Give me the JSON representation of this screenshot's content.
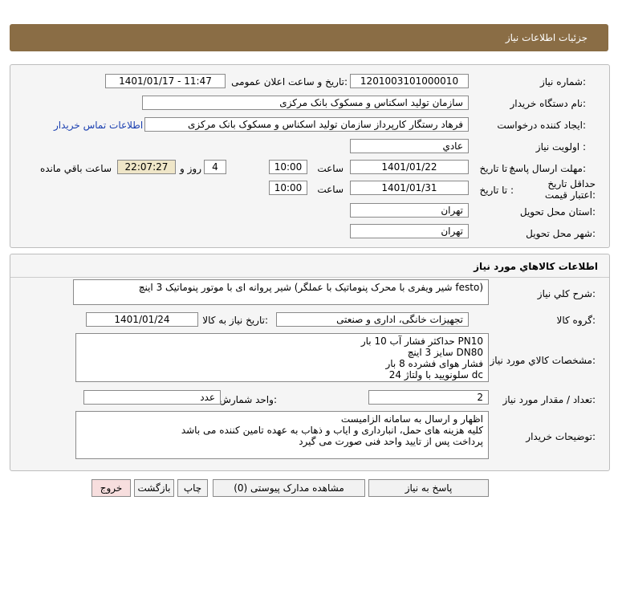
{
  "header": {
    "title": "جزئیات اطلاعات نیاز"
  },
  "need_info": {
    "need_number_label": "شماره نیاز:",
    "need_number": "1201003101000010",
    "announce_label": "تاریخ و ساعت اعلان عمومی:",
    "announce_value": "1401/01/17 - 11:47",
    "buyer_org_label": "نام دستگاه خریدار:",
    "buyer_org": "سازمان تولید اسکناس و مسکوک بانک مرکزی",
    "creator_label": "ایجاد کننده درخواست:",
    "creator": "فرهاد رستگار کارپرداز سازمان تولید اسکناس و مسکوک بانک مرکزی",
    "contact_link": "اطلاعات تماس خریدار",
    "priority_label": "اولویت نیاز :",
    "priority": "عادي",
    "deadline_label": "مهلت ارسال پاسخ:",
    "to_date_label": "تا تاریخ :",
    "deadline_date": "1401/01/22",
    "time_label": "ساعت",
    "deadline_time": "10:00",
    "days_value": "4",
    "days_label": "روز و",
    "remaining_time": "22:07:27",
    "remaining_label": "ساعت باقي مانده",
    "validity_label": "حداقل تاریخ اعتبار قیمت:",
    "validity_to_label": "تا تاریخ :",
    "validity_date": "1401/01/31",
    "validity_time_label": "ساعت",
    "validity_time": "10:00",
    "province_label": "استان محل تحویل:",
    "province": "تهران",
    "city_label": "شهر محل تحویل:",
    "city": "تهران"
  },
  "goods": {
    "section_title": "اطلاعات کالاهاي مورد نياز",
    "desc_label": "شرح کلي نياز:",
    "desc": "شیر پروانه ای با موتور پنوماتیک 3 اینچ (شیر ویفری با محرک پنوماتیک با عملگر festo)",
    "group_label": "گروه کالا:",
    "group": "تجهیزات خانگی، اداری و صنعتی",
    "need_date_label": "تاریخ نیاز به کالا:",
    "need_date": "1401/01/24",
    "specs_label": "مشخصات کالاي مورد نياز:",
    "specs": [
      "حداکثر فشار آب 10 بار PN10",
      "سایز 3 اینچ DN80",
      "فشار هوای فشرده 8 بار",
      "سلونویید با ولتاژ 24 dc"
    ],
    "qty_label": "تعداد / مقدار مورد نیاز:",
    "qty": "2",
    "unit_label": "واحد شمارش:",
    "unit": "عدد",
    "buyer_notes_label": "توضیحات خریدار:",
    "buyer_notes": [
      "اظهار و ارسال به سامانه الزامیست",
      "کلیه هزینه های حمل، انبارداری و ایاب و ذهاب به عهده تامین کننده می باشد",
      "پرداخت پس از تایید واحد فنی صورت می گیرد"
    ]
  },
  "buttons": {
    "reply": "پاسخ به نیاز",
    "attachments": "مشاهده مدارک پیوستی (0)",
    "print": "چاپ",
    "back": "بازگشت",
    "exit": "خروج"
  },
  "colors": {
    "header_bg": "#8a6d45",
    "link": "#1a3fb0",
    "timer_bg": "#efe6c8",
    "exit_bg": "#f7dede"
  }
}
